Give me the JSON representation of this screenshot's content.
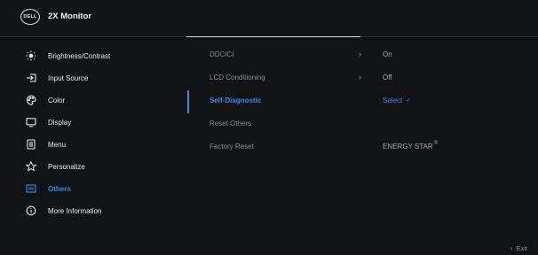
{
  "header": {
    "logo_text": "DELL",
    "model": "2X Monitor"
  },
  "menu": [
    {
      "label": "Brightness/Contrast",
      "icon": "brightness-icon",
      "active": false
    },
    {
      "label": "Input Source",
      "icon": "input-source-icon",
      "active": false
    },
    {
      "label": "Color",
      "icon": "color-palette-icon",
      "active": false
    },
    {
      "label": "Display",
      "icon": "display-icon",
      "active": false
    },
    {
      "label": "Menu",
      "icon": "menu-icon",
      "active": false
    },
    {
      "label": "Personalize",
      "icon": "star-icon",
      "active": false
    },
    {
      "label": "Others",
      "icon": "others-icon",
      "active": true
    },
    {
      "label": "More Information",
      "icon": "info-icon",
      "active": false
    }
  ],
  "submenu": [
    {
      "label": "DDC/CI",
      "has_arrow": true,
      "value": "On"
    },
    {
      "label": "LCD Conditioning",
      "has_arrow": true,
      "value": "Off"
    },
    {
      "label": "Self-Diagnostic",
      "has_arrow": false,
      "value": "Select",
      "active": true
    },
    {
      "label": "Reset Others",
      "has_arrow": false,
      "value": ""
    },
    {
      "label": "Factory Reset",
      "has_arrow": false,
      "value": "ENERGY STAR"
    }
  ],
  "energy_star_mark": "®",
  "footer": {
    "exit_label": "Exit"
  },
  "colors": {
    "accent": "#2b8ff2",
    "background": "#121314",
    "text": "#e8e8e8",
    "muted": "#8a8b8d"
  }
}
